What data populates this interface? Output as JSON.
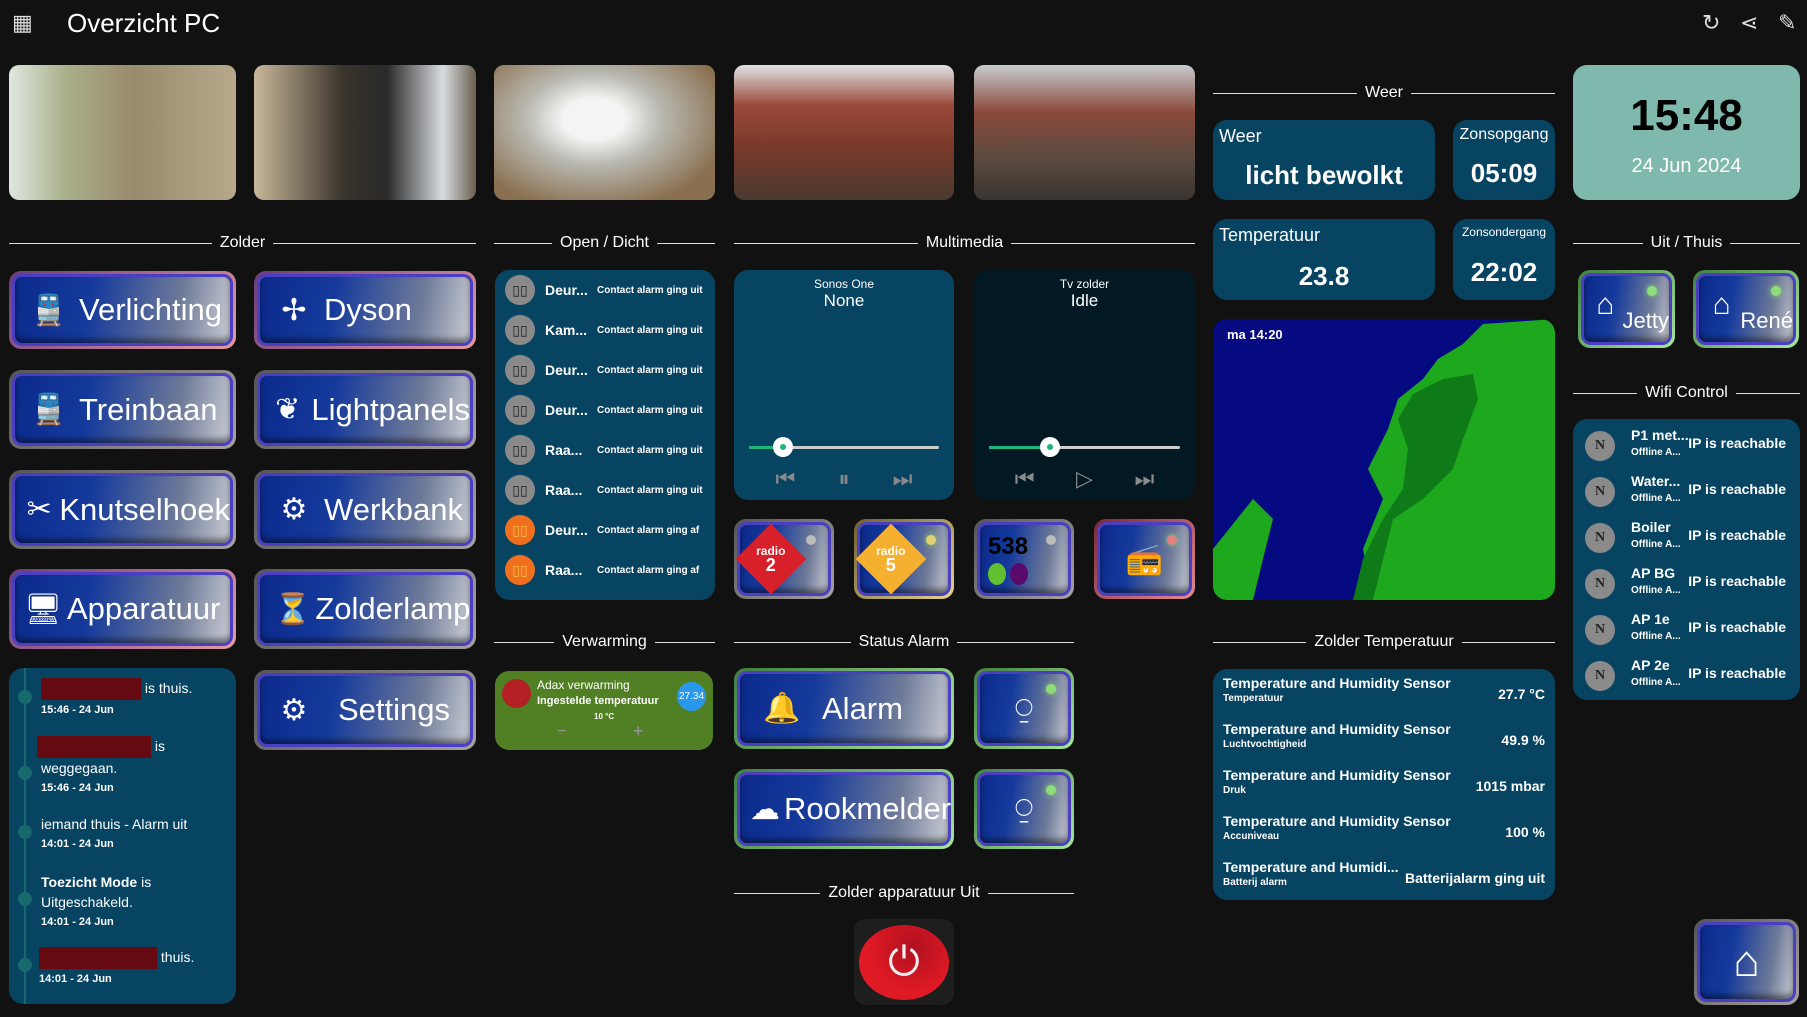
{
  "header": {
    "title": "Overzicht PC",
    "icons": [
      "grid-icon",
      "refresh-icon",
      "share-icon",
      "edit-icon"
    ]
  },
  "sections": {
    "zolder": "Zolder",
    "open_dicht": "Open / Dicht",
    "multimedia": "Multimedia",
    "weer": "Weer",
    "uit_thuis": "Uit / Thuis",
    "wifi": "Wifi Control",
    "verwarming": "Verwarming",
    "status_alarm": "Status Alarm",
    "zolder_temp": "Zolder Temperatuur",
    "zolder_app_uit": "Zolder apparatuur Uit"
  },
  "zolder_buttons": [
    {
      "label": "Verlichting",
      "icon": "train-icon"
    },
    {
      "label": "Dyson",
      "icon": "fan-icon"
    },
    {
      "label": "Treinbaan",
      "icon": "train-icon"
    },
    {
      "label": "Lightpanels",
      "icon": "leaf-icon"
    },
    {
      "label": "Knutselhoek",
      "icon": "tools-icon"
    },
    {
      "label": "Werkbank",
      "icon": "workbench-icon"
    },
    {
      "label": "Apparatuur",
      "icon": "computer-icon"
    },
    {
      "label": "Zolderlamp",
      "icon": "lamp-icon"
    },
    {
      "label": "Settings",
      "icon": "gears-icon"
    }
  ],
  "timeline": [
    {
      "text": "is thuis.",
      "time": "15:46 - 24 Jun"
    },
    {
      "text": "is",
      "text2": "weggegaan.",
      "time": "15:46 - 24 Jun"
    },
    {
      "text": "iemand thuis - Alarm uit",
      "time": "14:01 - 24 Jun"
    },
    {
      "bold": "Toezicht Mode",
      "text": " is",
      "text2": "Uitgeschakeld.",
      "time": "14:01 - 24 Jun"
    },
    {
      "text": "thuis.",
      "time": "14:01 - 24 Jun"
    }
  ],
  "open_dicht": [
    {
      "name": "Deur...",
      "state": "Contact alarm ging uit",
      "on": false
    },
    {
      "name": "Kam...",
      "state": "Contact alarm ging uit",
      "on": false
    },
    {
      "name": "Deur...",
      "state": "Contact alarm ging uit",
      "on": false
    },
    {
      "name": "Deur...",
      "state": "Contact alarm ging uit",
      "on": false
    },
    {
      "name": "Raa...",
      "state": "Contact alarm ging uit",
      "on": false
    },
    {
      "name": "Raa...",
      "state": "Contact alarm ging uit",
      "on": false
    },
    {
      "name": "Deur...",
      "state": "Contact alarm ging af",
      "on": true
    },
    {
      "name": "Raa...",
      "state": "Contact alarm ging af",
      "on": true
    }
  ],
  "verwarming": {
    "name": "Adax verwarming",
    "label": "Ingestelde temperatuur",
    "setpoint": "10 °C",
    "current": "27.34",
    "minus": "−",
    "plus": "+"
  },
  "media": [
    {
      "name": "Sonos One",
      "state": "None",
      "volume": 0.18,
      "play_icon": "pause-icon"
    },
    {
      "name": "Tv zolder",
      "state": "Idle",
      "volume": 0.32,
      "play_icon": "play-icon"
    }
  ],
  "radio_buttons": [
    {
      "name": "npo radio 2",
      "l1": "radio",
      "l2": "2"
    },
    {
      "name": "npo radio 5",
      "l1": "radio",
      "l2": "5"
    },
    {
      "name": "radio 538",
      "l1": "538"
    },
    {
      "name": "radio",
      "icon": "radio-icon"
    }
  ],
  "alarm": {
    "alarm_label": "Alarm",
    "rook_label": "Rookmelder"
  },
  "weather": {
    "weer_label": "Weer",
    "weer_value": "licht bewolkt",
    "temp_label": "Temperatuur",
    "temp_value": "23.8",
    "sunrise_label": "Zonsopgang",
    "sunrise": "05:09",
    "sunset_label": "Zonsondergang",
    "sunset": "22:02",
    "map_time": "ma 14:20"
  },
  "clock": {
    "time": "15:48",
    "date": "24 Jun 2024"
  },
  "uit_thuis": [
    {
      "label": "Jetty"
    },
    {
      "label": "René"
    }
  ],
  "wifi": [
    {
      "name": "P1 met...",
      "sub": "Offline A...",
      "state": "IP is reachable"
    },
    {
      "name": "Water...",
      "sub": "Offline A...",
      "state": "IP is reachable"
    },
    {
      "name": "Boiler",
      "sub": "Offline A...",
      "state": "IP is reachable"
    },
    {
      "name": "AP BG",
      "sub": "Offline A...",
      "state": "IP is reachable"
    },
    {
      "name": "AP 1e",
      "sub": "Offline A...",
      "state": "IP is reachable"
    },
    {
      "name": "AP 2e",
      "sub": "Offline A...",
      "state": "IP is reachable"
    }
  ],
  "zolder_temp": [
    {
      "name": "Temperature and Humidity Sensor",
      "sub": "Temperatuur",
      "value": "27.7 °C"
    },
    {
      "name": "Temperature and Humidity Sensor",
      "sub": "Luchtvochtigheid",
      "value": "49.9 %"
    },
    {
      "name": "Temperature and Humidity Sensor",
      "sub": "Druk",
      "value": "1015 mbar"
    },
    {
      "name": "Temperature and Humidity Sensor",
      "sub": "Accuniveau",
      "value": "100 %"
    },
    {
      "name": "Temperature and Humidi...",
      "sub": "Batterij alarm",
      "value": "Batterijalarm ging uit"
    }
  ]
}
